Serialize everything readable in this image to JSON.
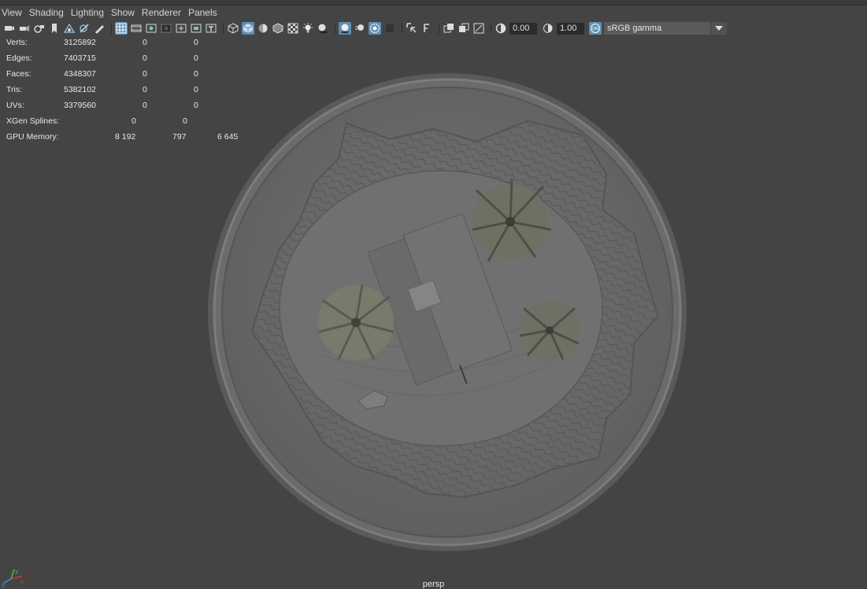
{
  "menu": [
    "View",
    "Shading",
    "Lighting",
    "Show",
    "Renderer",
    "Panels"
  ],
  "toolbar": {
    "exposure": "0.00",
    "gamma": "1.00",
    "color_space": "sRGB gamma",
    "icons_group1": [
      "camera-select-icon",
      "camera-attr-icon",
      "bookmark-camera-icon",
      "bookmark-icon",
      "image-plane-icon",
      "film-gate-icon",
      "grease-pencil-icon"
    ],
    "icons_group2": [
      "grid-icon",
      "film-gate-toggle-icon",
      "resolution-gate-icon",
      "gate-mask-icon",
      "field-chart-icon",
      "safe-action-icon",
      "safe-title-icon"
    ],
    "icons_group3": [
      "wireframe-icon",
      "smooth-shade-icon",
      "wireframe-on-shaded-icon",
      "xray-icon",
      "xray-joints-icon",
      "lighting-icon",
      "shadows-icon"
    ],
    "icons_group4": [
      "ambient-occlusion-icon",
      "motion-blur-icon",
      "anti-aliasing-icon",
      "depth-of-field-icon"
    ],
    "icons_group5": [
      "isolate-select-icon",
      "xray-active-icon"
    ],
    "icons_group6": [
      "two-sided-icon",
      "backface-icon",
      "uv-icon"
    ]
  },
  "hud": {
    "rows": [
      {
        "label": "Verts:",
        "v1": "3125892",
        "v2": "0",
        "v3": "0"
      },
      {
        "label": "Edges:",
        "v1": "7403715",
        "v2": "0",
        "v3": "0"
      },
      {
        "label": "Faces:",
        "v1": "4348307",
        "v2": "0",
        "v3": "0"
      },
      {
        "label": "Tris:",
        "v1": "5382102",
        "v2": "0",
        "v3": "0"
      },
      {
        "label": "UVs:",
        "v1": "3379560",
        "v2": "0",
        "v3": "0"
      }
    ],
    "xgen": {
      "label": "XGen Splines:",
      "v1": "0",
      "v2": "0"
    },
    "gpu": {
      "label": "GPU Memory:",
      "v1": "8 192",
      "v2": "797",
      "v3": "6 645"
    }
  },
  "camera_label": "persp",
  "axis": {
    "x": "x",
    "y": "y",
    "z": "z"
  },
  "colors": {
    "bg": "#444444",
    "active": "#5d8fb3",
    "field": "#2b2b2b"
  }
}
